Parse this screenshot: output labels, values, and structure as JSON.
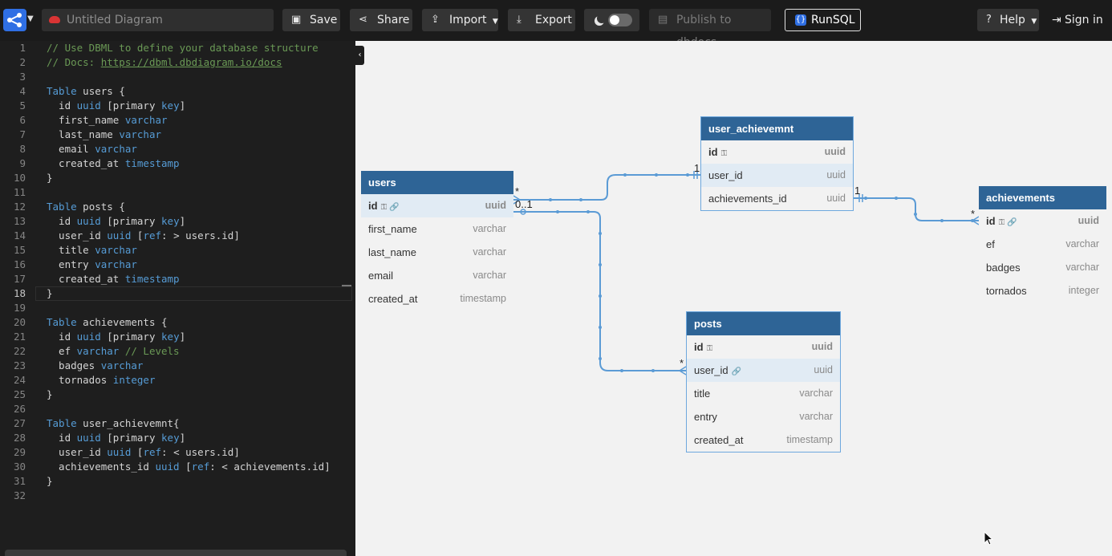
{
  "topbar": {
    "diagram_title": "Untitled Diagram",
    "buttons": {
      "save": "Save",
      "share": "Share",
      "import": "Import",
      "export": "Export",
      "publish": "Publish to dbdocs",
      "runsql": "RunSQL",
      "help": "Help",
      "signin": "Sign in"
    },
    "icons": [
      "logo-icon",
      "cloud-icon",
      "save-icon",
      "share-icon",
      "import-icon",
      "export-icon",
      "moon-icon",
      "publish-icon",
      "runsql-icon",
      "help-icon",
      "signin-icon"
    ]
  },
  "editor": {
    "lines": [
      {
        "n": "1",
        "segs": [
          {
            "t": "// Use DBML to define your database structure",
            "c": "com"
          }
        ]
      },
      {
        "n": "2",
        "segs": [
          {
            "t": "// Docs: ",
            "c": "com"
          },
          {
            "t": "https://dbml.dbdiagram.io/docs",
            "c": "link"
          }
        ]
      },
      {
        "n": "3",
        "segs": []
      },
      {
        "n": "4",
        "segs": [
          {
            "t": "Table",
            "c": "kw"
          },
          {
            "t": " users {",
            "c": ""
          }
        ]
      },
      {
        "n": "5",
        "segs": [
          {
            "t": "  id ",
            "c": ""
          },
          {
            "t": "uuid",
            "c": "kw"
          },
          {
            "t": " [primary ",
            "c": ""
          },
          {
            "t": "key",
            "c": "kw"
          },
          {
            "t": "]",
            "c": ""
          }
        ]
      },
      {
        "n": "6",
        "segs": [
          {
            "t": "  first_name ",
            "c": ""
          },
          {
            "t": "varchar",
            "c": "kw"
          }
        ]
      },
      {
        "n": "7",
        "segs": [
          {
            "t": "  last_name ",
            "c": ""
          },
          {
            "t": "varchar",
            "c": "kw"
          }
        ]
      },
      {
        "n": "8",
        "segs": [
          {
            "t": "  email ",
            "c": ""
          },
          {
            "t": "varchar",
            "c": "kw"
          }
        ]
      },
      {
        "n": "9",
        "segs": [
          {
            "t": "  created_at ",
            "c": ""
          },
          {
            "t": "timestamp",
            "c": "kw"
          }
        ]
      },
      {
        "n": "10",
        "segs": [
          {
            "t": "}",
            "c": ""
          }
        ]
      },
      {
        "n": "11",
        "segs": []
      },
      {
        "n": "12",
        "segs": [
          {
            "t": "Table",
            "c": "kw"
          },
          {
            "t": " posts {",
            "c": ""
          }
        ]
      },
      {
        "n": "13",
        "segs": [
          {
            "t": "  id ",
            "c": ""
          },
          {
            "t": "uuid",
            "c": "kw"
          },
          {
            "t": " [primary ",
            "c": ""
          },
          {
            "t": "key",
            "c": "kw"
          },
          {
            "t": "]",
            "c": ""
          }
        ]
      },
      {
        "n": "14",
        "segs": [
          {
            "t": "  user_id ",
            "c": ""
          },
          {
            "t": "uuid",
            "c": "kw"
          },
          {
            "t": " [",
            "c": ""
          },
          {
            "t": "ref",
            "c": "kw"
          },
          {
            "t": ": > users.id]",
            "c": ""
          }
        ]
      },
      {
        "n": "15",
        "segs": [
          {
            "t": "  title ",
            "c": ""
          },
          {
            "t": "varchar",
            "c": "kw"
          }
        ]
      },
      {
        "n": "16",
        "segs": [
          {
            "t": "  entry ",
            "c": ""
          },
          {
            "t": "varchar",
            "c": "kw"
          }
        ]
      },
      {
        "n": "17",
        "segs": [
          {
            "t": "  created_at ",
            "c": ""
          },
          {
            "t": "timestamp",
            "c": "kw"
          }
        ]
      },
      {
        "n": "18",
        "segs": [
          {
            "t": "}",
            "c": ""
          }
        ],
        "active": true
      },
      {
        "n": "19",
        "segs": []
      },
      {
        "n": "20",
        "segs": [
          {
            "t": "Table",
            "c": "kw"
          },
          {
            "t": " achievements {",
            "c": ""
          }
        ]
      },
      {
        "n": "21",
        "segs": [
          {
            "t": "  id ",
            "c": ""
          },
          {
            "t": "uuid",
            "c": "kw"
          },
          {
            "t": " [primary ",
            "c": ""
          },
          {
            "t": "key",
            "c": "kw"
          },
          {
            "t": "]",
            "c": ""
          }
        ]
      },
      {
        "n": "22",
        "segs": [
          {
            "t": "  ef ",
            "c": ""
          },
          {
            "t": "varchar",
            "c": "kw"
          },
          {
            "t": " // Levels",
            "c": "com"
          }
        ]
      },
      {
        "n": "23",
        "segs": [
          {
            "t": "  badges ",
            "c": ""
          },
          {
            "t": "varchar",
            "c": "kw"
          }
        ]
      },
      {
        "n": "24",
        "segs": [
          {
            "t": "  tornados ",
            "c": ""
          },
          {
            "t": "integer",
            "c": "kw"
          }
        ]
      },
      {
        "n": "25",
        "segs": [
          {
            "t": "}",
            "c": ""
          }
        ]
      },
      {
        "n": "26",
        "segs": []
      },
      {
        "n": "27",
        "segs": [
          {
            "t": "Table",
            "c": "kw"
          },
          {
            "t": " user_achievemnt{",
            "c": ""
          }
        ]
      },
      {
        "n": "28",
        "segs": [
          {
            "t": "  id ",
            "c": ""
          },
          {
            "t": "uuid",
            "c": "kw"
          },
          {
            "t": " [primary ",
            "c": ""
          },
          {
            "t": "key",
            "c": "kw"
          },
          {
            "t": "]",
            "c": ""
          }
        ]
      },
      {
        "n": "29",
        "segs": [
          {
            "t": "  user_id ",
            "c": ""
          },
          {
            "t": "uuid",
            "c": "kw"
          },
          {
            "t": " [",
            "c": ""
          },
          {
            "t": "ref",
            "c": "kw"
          },
          {
            "t": ": < users.id]",
            "c": ""
          }
        ]
      },
      {
        "n": "30",
        "segs": [
          {
            "t": "  achievements_id ",
            "c": ""
          },
          {
            "t": "uuid",
            "c": "kw"
          },
          {
            "t": " [",
            "c": ""
          },
          {
            "t": "ref",
            "c": "kw"
          },
          {
            "t": ": < achievements.id]",
            "c": ""
          }
        ]
      },
      {
        "n": "31",
        "segs": [
          {
            "t": "}",
            "c": ""
          }
        ]
      },
      {
        "n": "32",
        "segs": []
      }
    ]
  },
  "diagram": {
    "tables": {
      "users": {
        "name": "users",
        "fields": [
          {
            "name": "id",
            "type": "uuid",
            "pk": true,
            "keys": "⚿ 🔗"
          },
          {
            "name": "first_name",
            "type": "varchar"
          },
          {
            "name": "last_name",
            "type": "varchar"
          },
          {
            "name": "email",
            "type": "varchar"
          },
          {
            "name": "created_at",
            "type": "timestamp"
          }
        ]
      },
      "user_achievemnt": {
        "name": "user_achievemnt",
        "fields": [
          {
            "name": "id",
            "type": "uuid",
            "pk": true,
            "keys": "⚿"
          },
          {
            "name": "user_id",
            "type": "uuid"
          },
          {
            "name": "achievements_id",
            "type": "uuid"
          }
        ]
      },
      "achievements": {
        "name": "achievements",
        "fields": [
          {
            "name": "id",
            "type": "uuid",
            "pk": true,
            "keys": "⚿ 🔗"
          },
          {
            "name": "ef",
            "type": "varchar"
          },
          {
            "name": "badges",
            "type": "varchar"
          },
          {
            "name": "tornados",
            "type": "integer"
          }
        ]
      },
      "posts": {
        "name": "posts",
        "fields": [
          {
            "name": "id",
            "type": "uuid",
            "pk": true,
            "keys": "⚿"
          },
          {
            "name": "user_id",
            "type": "uuid",
            "keys": "🔗"
          },
          {
            "name": "title",
            "type": "varchar"
          },
          {
            "name": "entry",
            "type": "varchar"
          },
          {
            "name": "created_at",
            "type": "timestamp"
          }
        ]
      }
    },
    "cardinality": {
      "users_many": "*",
      "users_zero_one": "0..1",
      "ua_user_one": "1",
      "ua_ach_one": "1",
      "ach_many": "*",
      "posts_many": "*"
    },
    "colors": {
      "header": "#2e6496",
      "link": "#5b9bd5",
      "highlight": "#e1ebf4"
    }
  }
}
